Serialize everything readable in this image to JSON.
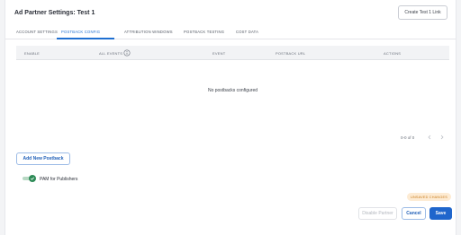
{
  "header": {
    "title": "Ad Partner Settings: Test 1",
    "create_link_label": "Create Test 1 Link"
  },
  "tabs": [
    {
      "label": "ACCOUNT SETTINGS",
      "active": false
    },
    {
      "label": "POSTBACK CONFIG",
      "active": true
    },
    {
      "label": "ATTRIBUTION WINDOWS",
      "active": false
    },
    {
      "label": "POSTBACK TESTING",
      "active": false
    },
    {
      "label": "COST DATA",
      "active": false
    }
  ],
  "table": {
    "columns": [
      "ENABLE",
      "ALL EVENTS",
      "EVENT",
      "POSTBACK URL",
      "ACTIONS"
    ],
    "empty_message": "No postbacks configured",
    "pagination": "0-0 of 0"
  },
  "add_postback_label": "Add New Postback",
  "pam_toggle": {
    "label": "PAM for Publishers",
    "enabled": true
  },
  "footer": {
    "unsaved_badge": "UNSAVED CHANGES",
    "disable_label": "Disable Partner",
    "cancel_label": "Cancel",
    "save_label": "Save"
  },
  "colors": {
    "accent": "#1f66cc",
    "toggle_on": "#2e8b57",
    "unsaved_bg": "#fdebd3",
    "unsaved_text": "#c77a18"
  },
  "icons": {
    "all_events_info": "info-icon",
    "prev_page": "chevron-left-icon",
    "next_page": "chevron-right-icon",
    "toggle_check": "check-icon"
  }
}
